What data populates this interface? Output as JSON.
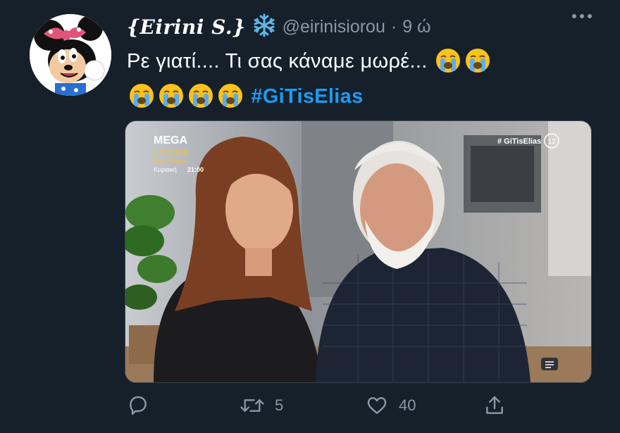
{
  "tweet": {
    "display_name": "{Eirini S.}",
    "handle": "@eirinisiorou",
    "separator": "·",
    "time": "9 ώ",
    "text_line1": "Ρε γιατί.... Τι σας κάναμε μωρέ...",
    "hashtag": "#GiTisElias",
    "emoji_icon": "loudly-crying-face-icon",
    "name_emoji_icon": "snowflake-icon"
  },
  "media": {
    "channel_logo": "MEGA",
    "promo_line1": "X FACTOR",
    "promo_line2": "Live Show",
    "promo_day": "Κυριακή",
    "promo_time": "21:00",
    "overlay_hashtag": "# GiTisElias",
    "rating_badge": "12"
  },
  "actions": {
    "reply_icon": "reply-icon",
    "retweet_icon": "retweet-icon",
    "retweet_count": "5",
    "like_icon": "heart-icon",
    "like_count": "40",
    "share_icon": "share-icon"
  },
  "colors": {
    "background": "#15202b",
    "accent": "#1d9bf0",
    "muted": "#8b98a5"
  }
}
